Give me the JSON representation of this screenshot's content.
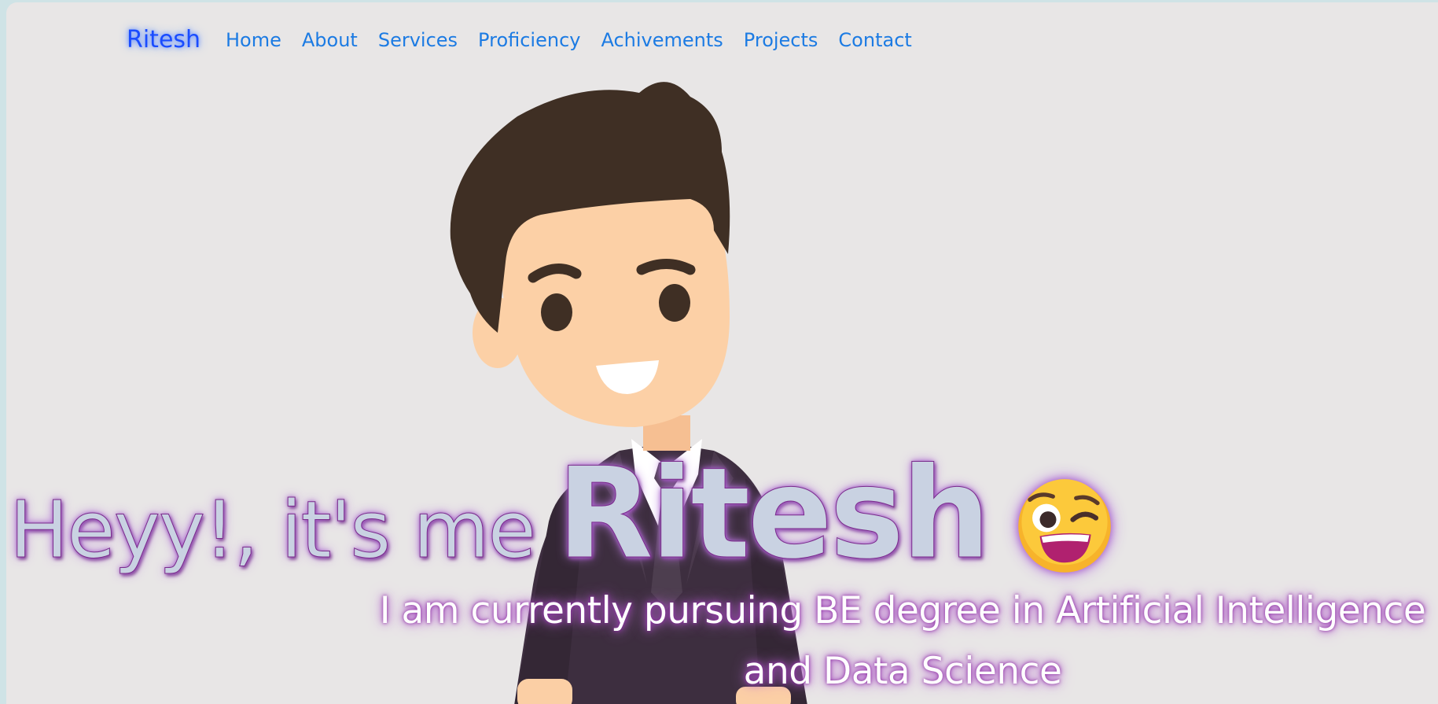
{
  "nav": {
    "brand": "Ritesh",
    "items": [
      {
        "label": "Home"
      },
      {
        "label": "About"
      },
      {
        "label": "Services"
      },
      {
        "label": "Proficiency"
      },
      {
        "label": "Achivements"
      },
      {
        "label": "Projects"
      },
      {
        "label": "Contact"
      }
    ]
  },
  "hero": {
    "greeting": "Heyy!, it's me",
    "name": "Ritesh",
    "emoji_icon": "winking-face-icon",
    "subtitle": "I am currently pursuing BE degree in Artificial Intelligence and Data Science"
  },
  "colors": {
    "page_bg": "#e8e6e6",
    "nav_link": "#1c7be3",
    "brand": "#1a4cff",
    "hero_text": "#c9d2e2",
    "glow": "#a35cc8"
  }
}
